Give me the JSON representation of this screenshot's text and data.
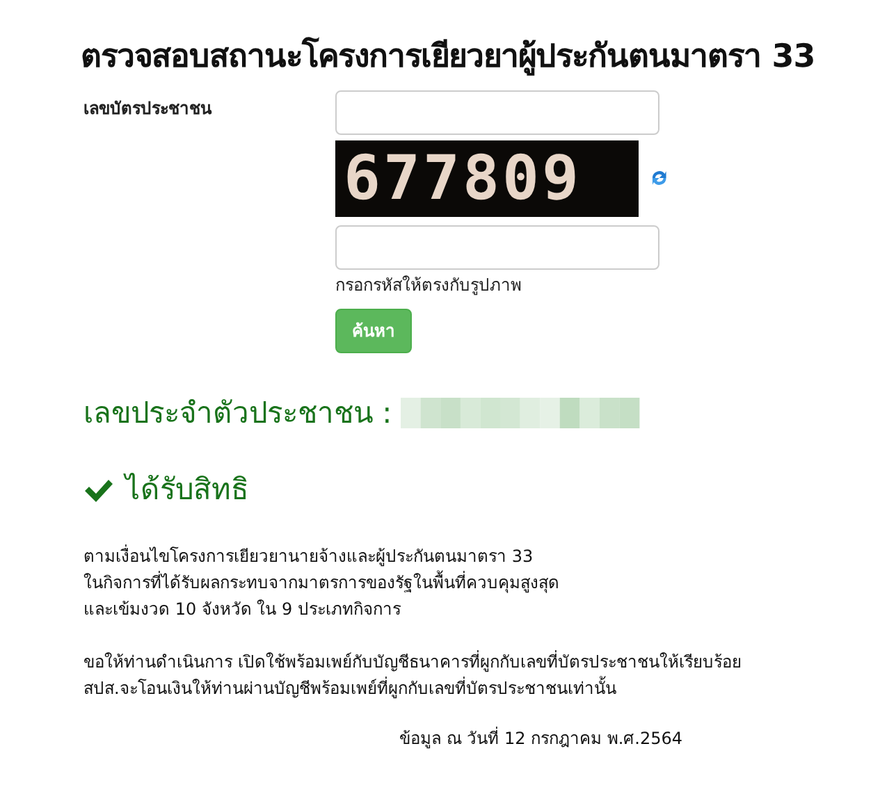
{
  "title": "ตรวจสอบสถานะโครงการเยียวยาผู้ประกันตนมาตรา 33",
  "form": {
    "id_label": "เลขบัตรประชาชน",
    "captcha": "677809",
    "captcha_hint": "กรอกรหัสให้ตรงกับรูปภาพ",
    "search_button": "ค้นหา"
  },
  "result": {
    "id_heading": "เลขประจำตัวประชาชน :",
    "eligible": true,
    "status": "ได้รับสิทธิ",
    "paragraphs": [
      [
        "ตามเงื่อนไขโครงการเยียวยานายจ้างและผู้ประกันตนมาตรา 33",
        "ในกิจการที่ได้รับผลกระทบจากมาตรการของรัฐในพื้นที่ควบคุมสูงสุด",
        "และเข้มงวด 10 จังหวัด ใน 9 ประเภทกิจการ"
      ],
      [
        "ขอให้ท่านดำเนินการ เปิดใช้พร้อมเพย์กับบัญชีธนาคารที่ผูกกับเลขที่บัตรประชาชนให้เรียบร้อย",
        "สปส.จะโอนเงินให้ท่านผ่านบัญชีพร้อมเพย์ที่ผูกกับเลขที่บัตรประชาชนเท่านั้น"
      ]
    ],
    "date_note": "ข้อมูล ณ วันที่ 12 กรกฎาคม พ.ศ.2564"
  }
}
